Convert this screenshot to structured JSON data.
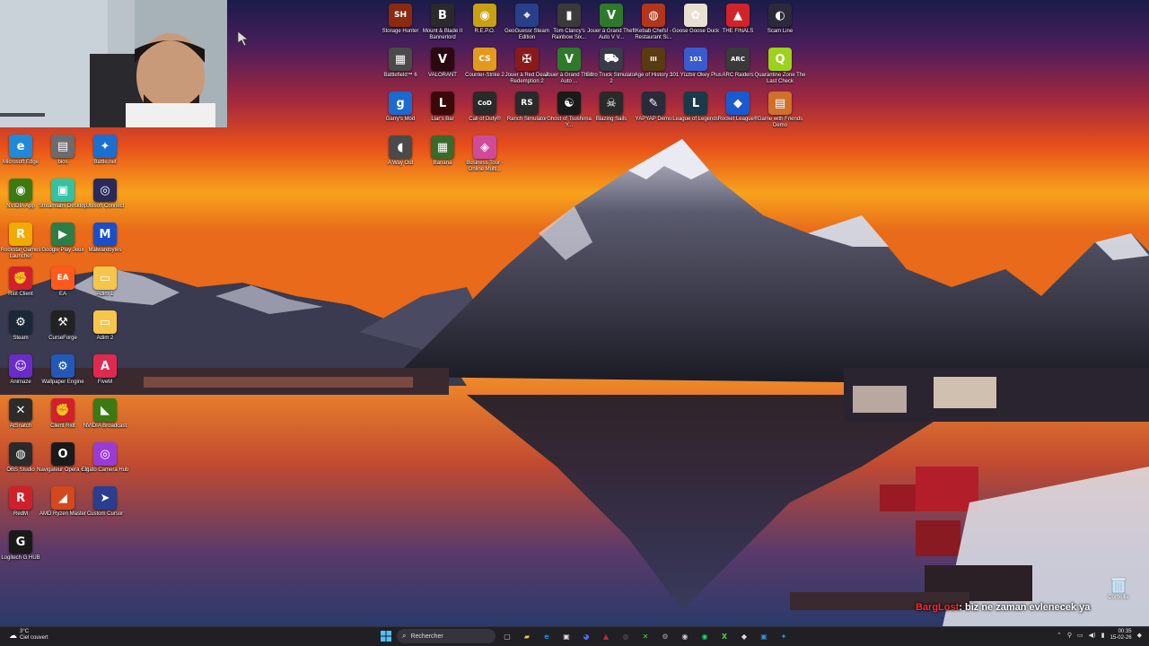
{
  "desktop": {
    "left_icons": [
      {
        "label": "Microsoft Edge",
        "color": "#1f8ad9",
        "glyph": "e"
      },
      {
        "label": "bios",
        "color": "#6b6b70",
        "glyph": "▤"
      },
      {
        "label": "Battle.net",
        "color": "#1a6fd0",
        "glyph": "✦"
      },
      {
        "label": "NVIDIA App",
        "color": "#3b7a12",
        "glyph": "◉"
      },
      {
        "label": "Streamlabs Desktop",
        "color": "#31c3a2",
        "glyph": "▣"
      },
      {
        "label": "Ubisoft Connect",
        "color": "#2a2a5a",
        "glyph": "◎"
      },
      {
        "label": "Rockstar Games Launcher",
        "color": "#f2a900",
        "glyph": "R"
      },
      {
        "label": "Google Play Jeux",
        "color": "#2d7d46",
        "glyph": "▶"
      },
      {
        "label": "Malwarebytes",
        "color": "#1a4fc7",
        "glyph": "M"
      },
      {
        "label": "Riot Client",
        "color": "#d3202d",
        "glyph": "✊"
      },
      {
        "label": "EA",
        "color": "#ff5a1e",
        "glyph": "EA"
      },
      {
        "label": "Adim 1",
        "color": "#f6c64a",
        "glyph": "▭"
      },
      {
        "label": "Steam",
        "color": "#1b2838",
        "glyph": "⚙"
      },
      {
        "label": "CurseForge",
        "color": "#222",
        "glyph": "⚒"
      },
      {
        "label": "Adim 2",
        "color": "#f6c64a",
        "glyph": "▭"
      },
      {
        "label": "Animaze",
        "color": "#6a2cc8",
        "glyph": "☺"
      },
      {
        "label": "Wallpaper Engine",
        "color": "#2258b8",
        "glyph": "⚙"
      },
      {
        "label": "FiveM",
        "color": "#e1284f",
        "glyph": "A"
      },
      {
        "label": "AtSnatch",
        "color": "#2c2c2c",
        "glyph": "✕"
      },
      {
        "label": "Client Riot",
        "color": "#d3202d",
        "glyph": "✊"
      },
      {
        "label": "NVIDIA Broadcast",
        "color": "#3b7a12",
        "glyph": "◣"
      },
      {
        "label": "OBS Studio",
        "color": "#2b2b2b",
        "glyph": "◍"
      },
      {
        "label": "Navigateur Opera GX",
        "color": "#1a1a1a",
        "glyph": "O"
      },
      {
        "label": "Elgato Camera Hub",
        "color": "#9b3bd6",
        "glyph": "◎"
      },
      {
        "label": "RedM",
        "color": "#d0202a",
        "glyph": "R"
      },
      {
        "label": "AMD Ryzen Master",
        "color": "#d5481b",
        "glyph": "◢"
      },
      {
        "label": "Custom Cursor",
        "color": "#2a3d8f",
        "glyph": "➤"
      },
      {
        "label": "Logitech G HUB",
        "color": "#1a1a1a",
        "glyph": "G"
      }
    ],
    "top_icons": [
      {
        "label": "Storage Hunter",
        "color": "#8a2a10",
        "glyph": "SH"
      },
      {
        "label": "Mount & Blade II Bannerlord",
        "color": "#2a2a2a",
        "glyph": "B"
      },
      {
        "label": "R.E.P.O.",
        "color": "#c9a010",
        "glyph": "◉"
      },
      {
        "label": "GeoGuessr Steam Edition",
        "color": "#2a3f8a",
        "glyph": "⌖"
      },
      {
        "label": "Tom Clancy's Rainbow Six...",
        "color": "#3a3a3a",
        "glyph": "▮"
      },
      {
        "label": "Jouer à Grand Theft Auto V V...",
        "color": "#2f7a2a",
        "glyph": "V"
      },
      {
        "label": "Kebab Chefs! - Restaurant Si...",
        "color": "#b3351b",
        "glyph": "◍"
      },
      {
        "label": "Goose Goose Duck",
        "color": "#e8e0d0",
        "glyph": "✿"
      },
      {
        "label": "THE FINALS",
        "color": "#d2232a",
        "glyph": "▲"
      },
      {
        "label": "Scam Line",
        "color": "#2a2a3a",
        "glyph": "◐"
      },
      {
        "label": "Battlefield™ 6",
        "color": "#4a4a4a",
        "glyph": "▦"
      },
      {
        "label": "VALORANT",
        "color": "#2a0a10",
        "glyph": "V"
      },
      {
        "label": "Counter-Strike 2",
        "color": "#e39a1b",
        "glyph": "CS"
      },
      {
        "label": "Jouer à Red Dead Redemption 2",
        "color": "#8a1a1a",
        "glyph": "✠"
      },
      {
        "label": "Jouer à Grand Theft Auto ...",
        "color": "#2f7a2a",
        "glyph": "V"
      },
      {
        "label": "Euro Truck Simulator 2",
        "color": "#3a3a4a",
        "glyph": "⛟"
      },
      {
        "label": "Age of History 3",
        "color": "#5a3a10",
        "glyph": "III"
      },
      {
        "label": "101 Yüzbir Okey Plus",
        "color": "#3a5ad0",
        "glyph": "101"
      },
      {
        "label": "ARC Raiders",
        "color": "#3a3a3a",
        "glyph": "ARC"
      },
      {
        "label": "Quarantine Zone The Last Check",
        "color": "#9bd21a",
        "glyph": "Q"
      },
      {
        "label": "Garry's Mod",
        "color": "#1a6ad0",
        "glyph": "g"
      },
      {
        "label": "Liar's Bar",
        "color": "#3a0a0a",
        "glyph": "L"
      },
      {
        "label": "Call of Duty®",
        "color": "#2a2a2a",
        "glyph": "CoD"
      },
      {
        "label": "Ranch Simulator",
        "color": "#2a2a2a",
        "glyph": "RS"
      },
      {
        "label": "Ghost of Tsushima Y...",
        "color": "#1a1a1a",
        "glyph": "☯"
      },
      {
        "label": "Blazing Sails",
        "color": "#2a2a2a",
        "glyph": "☠"
      },
      {
        "label": "YAPYAP Demo",
        "color": "#2a2a3a",
        "glyph": "✎"
      },
      {
        "label": "League of Legends",
        "color": "#1a3a4a",
        "glyph": "L"
      },
      {
        "label": "Rocket League®",
        "color": "#1a5ad0",
        "glyph": "◆"
      },
      {
        "label": "Game with Friends Demo",
        "color": "#d0702a",
        "glyph": "▤"
      },
      {
        "label": "A Way Out",
        "color": "#4a4a4a",
        "glyph": "◖"
      },
      {
        "label": "Banana",
        "color": "#3a6a2a",
        "glyph": "▦"
      },
      {
        "label": "Business Tour - Online Multi...",
        "color": "#d04a9a",
        "glyph": "◈"
      }
    ],
    "recycle_bin": {
      "label": "Corbeille"
    }
  },
  "chat": {
    "username": "BargLost",
    "message": ": biz ne zaman evlenecek ya"
  },
  "taskbar": {
    "weather": {
      "temp": "3°C",
      "condition": "Ciel couvert"
    },
    "search_placeholder": "Rechercher",
    "apps": [
      {
        "name": "task-view-icon",
        "glyph": "▢",
        "color": "#ccc"
      },
      {
        "name": "file-explorer-icon",
        "glyph": "▰",
        "color": "#f6c64a"
      },
      {
        "name": "edge-icon",
        "glyph": "e",
        "color": "#1f8ad9"
      },
      {
        "name": "store-icon",
        "glyph": "▣",
        "color": "#ddd"
      },
      {
        "name": "discord-icon",
        "glyph": "◕",
        "color": "#5865f2"
      },
      {
        "name": "riot-icon",
        "glyph": "▲",
        "color": "#d3202d"
      },
      {
        "name": "epic-icon",
        "glyph": "◍",
        "color": "#555"
      },
      {
        "name": "xbox-icon",
        "glyph": "✕",
        "color": "#4ccf4c"
      },
      {
        "name": "steam-icon",
        "glyph": "⚙",
        "color": "#aab"
      },
      {
        "name": "github-icon",
        "glyph": "◉",
        "color": "#ccc"
      },
      {
        "name": "spotify-icon",
        "glyph": "◉",
        "color": "#1ed760"
      },
      {
        "name": "xbox-app-icon",
        "glyph": "X",
        "color": "#4ccf4c"
      },
      {
        "name": "capcut-icon",
        "glyph": "◆",
        "color": "#ddd"
      },
      {
        "name": "photos-icon",
        "glyph": "▣",
        "color": "#3a8ad0"
      },
      {
        "name": "vscode-icon",
        "glyph": "✦",
        "color": "#2a9ae0"
      }
    ],
    "clock": {
      "time": "00:35",
      "date": "15-02-26"
    }
  }
}
